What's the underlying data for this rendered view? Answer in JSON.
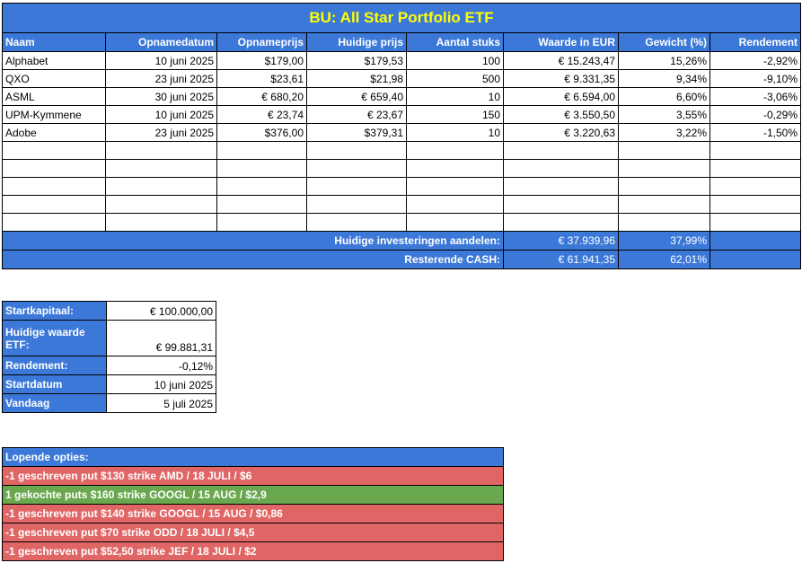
{
  "title": "BU: All Star Portfolio ETF",
  "columns": [
    "Naam",
    "Opnamedatum",
    "Opnameprijs",
    "Huidige prijs",
    "Aantal stuks",
    "Waarde in EUR",
    "Gewicht (%)",
    "Rendement"
  ],
  "holdings": [
    {
      "naam": "Alphabet",
      "datum": "10 juni 2025",
      "opnameprijs": "$179,00",
      "huidige": "$179,53",
      "aantal": "100",
      "waarde": "€ 15.243,47",
      "gewicht": "15,26%",
      "rendement": "-2,92%"
    },
    {
      "naam": "QXO",
      "datum": "23 juni 2025",
      "opnameprijs": "$23,61",
      "huidige": "$21,98",
      "aantal": "500",
      "waarde": "€ 9.331,35",
      "gewicht": "9,34%",
      "rendement": "-9,10%"
    },
    {
      "naam": "ASML",
      "datum": "30 juni 2025",
      "opnameprijs": "€ 680,20",
      "huidige": "€ 659,40",
      "aantal": "10",
      "waarde": "€ 6.594,00",
      "gewicht": "6,60%",
      "rendement": "-3,06%"
    },
    {
      "naam": "UPM-Kymmene",
      "datum": "10 juni 2025",
      "opnameprijs": "€ 23,74",
      "huidige": "€ 23,67",
      "aantal": "150",
      "waarde": "€ 3.550,50",
      "gewicht": "3,55%",
      "rendement": "-0,29%"
    },
    {
      "naam": "Adobe",
      "datum": "23 juni 2025",
      "opnameprijs": "$376,00",
      "huidige": "$379,31",
      "aantal": "10",
      "waarde": "€ 3.220,63",
      "gewicht": "3,22%",
      "rendement": "-1,50%"
    }
  ],
  "totals": {
    "invest_label": "Huidige investeringen aandelen:",
    "invest_value": "€ 37.939,96",
    "invest_weight": "37,99%",
    "cash_label": "Resterende CASH:",
    "cash_value": "€ 61.941,35",
    "cash_weight": "62,01%"
  },
  "summary": {
    "startkapitaal_label": "Startkapitaal:",
    "startkapitaal_value": "€ 100.000,00",
    "huidige_label": "Huidige waarde ETF:",
    "huidige_value": "€ 99.881,31",
    "rendement_label": "Rendement:",
    "rendement_value": "-0,12%",
    "startdatum_label": "Startdatum",
    "startdatum_value": "10 juni 2025",
    "vandaag_label": "Vandaag",
    "vandaag_value": "5 juli 2025"
  },
  "options": {
    "header": "Lopende opties:",
    "items": [
      {
        "text": "-1 geschreven put $130 strike AMD / 18 JULI / $6",
        "color": "#e06666"
      },
      {
        "text": "1 gekochte puts $160 strike GOOGL / 15 AUG / $2,9",
        "color": "#6aa84f"
      },
      {
        "text": "-1 geschreven put $140 strike GOOGL / 15 AUG / $0,86",
        "color": "#e06666"
      },
      {
        "text": "-1 geschreven put $70 strike ODD / 18 JULI / $4,5",
        "color": "#e06666"
      },
      {
        "text": "-1 geschreven put $52,50 strike JEF / 18 JULI / $2",
        "color": "#e06666"
      }
    ]
  },
  "colors": {
    "header_blue": "#3c78d8",
    "title_yellow": "#ffff00",
    "loss_red": "#e06666",
    "gain_green": "#6aa84f"
  }
}
